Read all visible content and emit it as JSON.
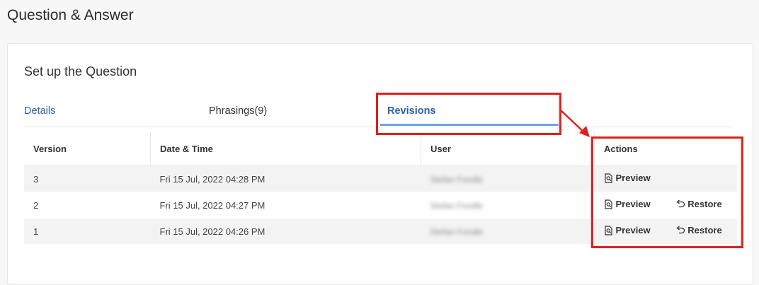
{
  "page": {
    "title": "Question & Answer"
  },
  "card": {
    "title": "Set up the Question"
  },
  "tabs": [
    {
      "label": "Details",
      "active": false
    },
    {
      "label": "Phrasings(9)",
      "active": false
    },
    {
      "label": "Revisions",
      "active": true
    }
  ],
  "table": {
    "headers": [
      "Version",
      "Date & Time",
      "User",
      "Actions"
    ],
    "rows": [
      {
        "version": "3",
        "datetime": "Fri 15 Jul, 2022 04:28 PM",
        "user": "Stefan Fondle",
        "actions": [
          "Preview"
        ]
      },
      {
        "version": "2",
        "datetime": "Fri 15 Jul, 2022 04:27 PM",
        "user": "Stefan Fondle",
        "actions": [
          "Preview",
          "Restore"
        ]
      },
      {
        "version": "1",
        "datetime": "Fri 15 Jul, 2022 04:26 PM",
        "user": "Stefan Fondle",
        "actions": [
          "Preview",
          "Restore"
        ]
      }
    ]
  },
  "icons": {
    "preview": "magnify-document-icon",
    "restore": "undo-arrow-icon"
  },
  "colors": {
    "link": "#2f5fa8",
    "active_tab_underline": "#6ea3e6",
    "annotation": "#e0201b"
  }
}
